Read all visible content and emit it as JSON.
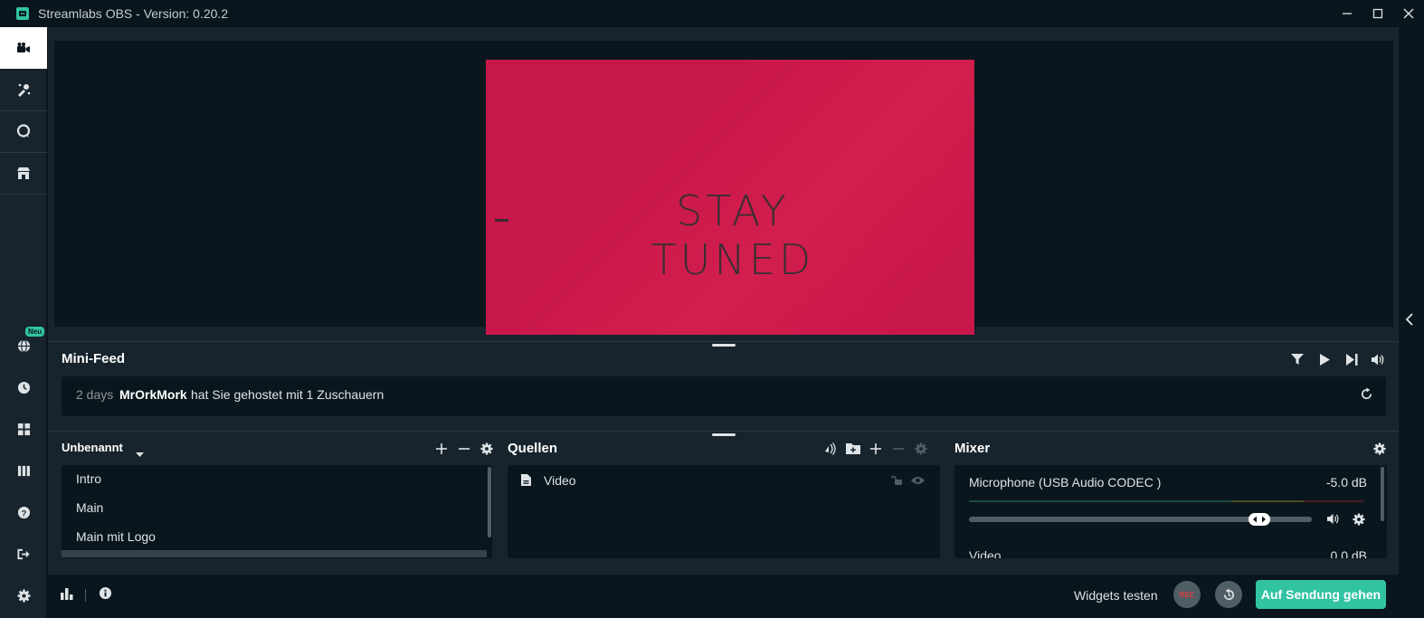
{
  "window": {
    "title": "Streamlabs OBS - Version: 0.20.2",
    "controls": [
      "minimize-icon",
      "maximize-icon",
      "close-icon"
    ]
  },
  "nav": {
    "items": [
      {
        "name": "studio",
        "icon": "camera-icon",
        "active": true
      },
      {
        "name": "themes",
        "icon": "paint-icon"
      },
      {
        "name": "chatbot",
        "icon": "chat-icon"
      },
      {
        "name": "store",
        "icon": "store-icon"
      },
      {
        "name": "browse",
        "icon": "globe-icon",
        "badge": "Neu"
      },
      {
        "name": "recording-history",
        "icon": "history-icon"
      },
      {
        "name": "layout",
        "icon": "layout-icon"
      },
      {
        "name": "studio-mode",
        "icon": "columns-icon"
      },
      {
        "name": "help",
        "icon": "help-icon"
      },
      {
        "name": "logout",
        "icon": "logout-icon"
      },
      {
        "name": "settings",
        "icon": "gear-icon"
      }
    ]
  },
  "preview": {
    "text": "STAY TUNED",
    "colors": {
      "background": "#c8174a",
      "text": "#3b2e33"
    }
  },
  "minifeed": {
    "title": "Mini-Feed",
    "controls": [
      "filter-icon",
      "play-icon",
      "skip-icon",
      "volume-icon"
    ],
    "item": {
      "time": "2 days",
      "user": "MrOrkMork",
      "message": "hat Sie gehostet mit 1 Zuschauern"
    }
  },
  "scenes": {
    "title": "Unbenannt",
    "items": [
      "Intro",
      "Main",
      "Main mit Logo"
    ]
  },
  "sources": {
    "title": "Quellen",
    "items": [
      {
        "name": "Video",
        "icon": "file-icon"
      }
    ]
  },
  "mixer": {
    "title": "Mixer",
    "channels": [
      {
        "name": "Microphone (USB Audio CODEC )",
        "db": "-5.0 dB",
        "level": 0.87
      },
      {
        "name": "Video",
        "db": "0.0 dB"
      }
    ]
  },
  "footer": {
    "widgets_test": "Widgets testen",
    "rec_label": "REC",
    "go_live": "Auf Sendung gehen"
  },
  "colors": {
    "accent": "#31c3a2",
    "panel": "#17242d",
    "dark": "#09161d",
    "rec": "#e23b3b"
  }
}
